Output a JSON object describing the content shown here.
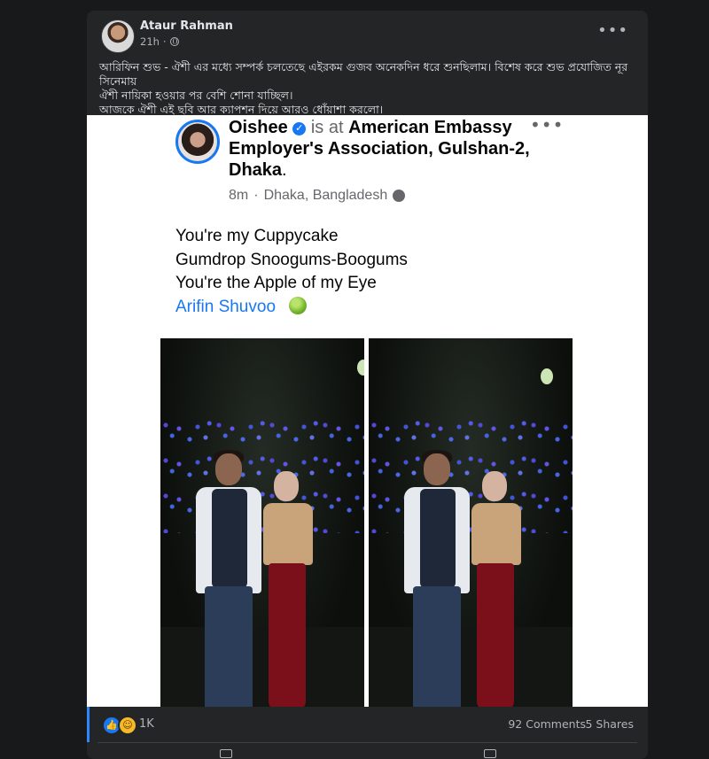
{
  "post": {
    "author": "Ataur Rahman",
    "time": "21h",
    "privacy_icon": "globe-icon",
    "text": "আরিফিন শুভ - ঐশী এর মধ্যে সম্পর্ক চলতেছে এইরকম গুজব অনেকদিন ধরে শুনছিলাম। বিশেষ করে শুভ প্রযোজিত নূর সিনেমায়\nঐশী নায়িকা হওয়ার পর বেশি শোনা যাচ্ছিল।\nআজকে ঐশী এই ছবি আর ক্যাপশন দিয়ে আরও ধোঁয়াশা করলো।",
    "more_icon": "•••"
  },
  "embedded_post": {
    "name": "Oishee",
    "is_at": "is at",
    "place": "American Embassy Employer's Association, Gulshan-2, Dhaka",
    "period": ".",
    "time": "8m",
    "separator": "·",
    "location": "Dhaka, Bangladesh",
    "more_icon": "•••",
    "lines": [
      "You're my Cuppycake",
      "Gumdrop Snoogums-Boogums",
      "You're the Apple of my Eye"
    ],
    "mention": "Arifin Shuvoo"
  },
  "reactions": {
    "count": "1K",
    "comments": "92 Comments",
    "shares": "5 Shares"
  },
  "colors": {
    "background": "#18191a",
    "card": "#242526",
    "accent": "#1877f2"
  }
}
